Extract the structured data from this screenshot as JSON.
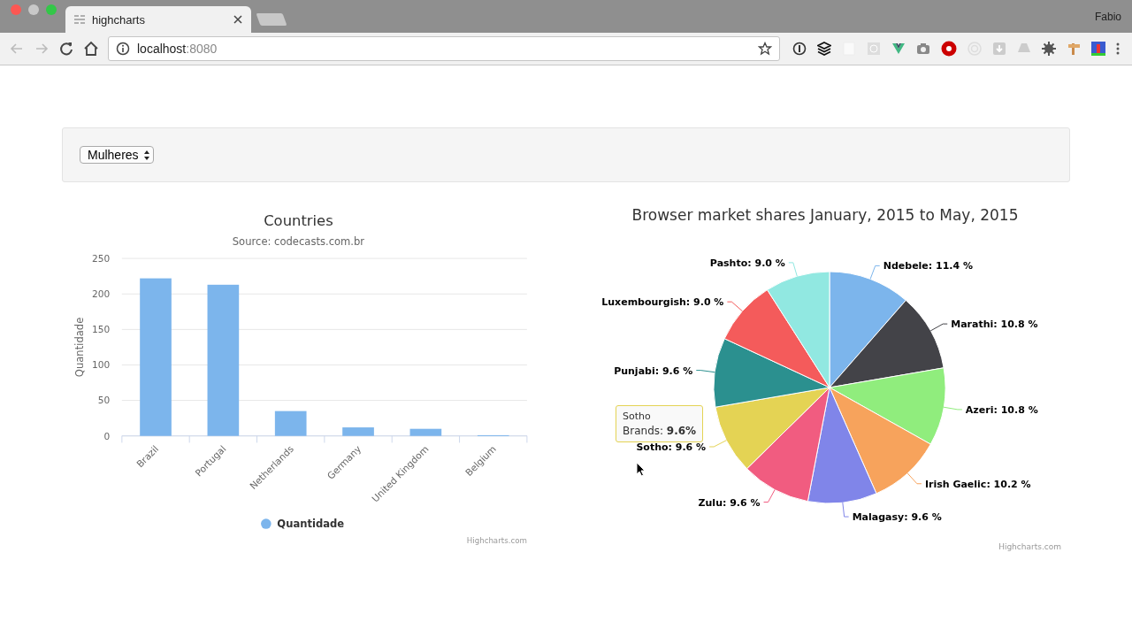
{
  "browser": {
    "tab": {
      "title": "highcharts",
      "selected": true
    },
    "address": {
      "host": "localhost",
      "port": ":8080"
    },
    "profile": "Fabio"
  },
  "filter": {
    "value": "Mulheres"
  },
  "bar_chart": {
    "subtitle": "Source: codecasts.com.br",
    "credits": "Highcharts.com",
    "chart_data": {
      "type": "bar",
      "title": "Countries",
      "ylabel": "Quantidade",
      "categories": [
        "Brazil",
        "Portugal",
        "Netherlands",
        "Germany",
        "United Kingdom",
        "Belgium"
      ],
      "series": [
        {
          "name": "Quantidade",
          "color": "#7cb5ec",
          "values": [
            222,
            213,
            35,
            12,
            10,
            1
          ]
        }
      ],
      "ylim": [
        0,
        250
      ],
      "yticks": [
        0,
        50,
        100,
        150,
        200,
        250
      ],
      "grid": true
    }
  },
  "pie_chart": {
    "credits": "Highcharts.com",
    "tooltip": {
      "title": "Sotho",
      "value": "9.6%"
    },
    "label_separator": ": ",
    "value_suffix": " %",
    "value_labels": [
      "11.4",
      "10.8",
      "10.8",
      "10.2",
      "9.6",
      "9.6",
      "9.6",
      "9.6",
      "9.0",
      "9.0"
    ],
    "chart_data": {
      "type": "pie",
      "title": "Browser market shares January, 2015 to May, 2015",
      "categories": [
        "Ndebele",
        "Marathi",
        "Azeri",
        "Irish Gaelic",
        "Malagasy",
        "Zulu",
        "Sotho",
        "Punjabi",
        "Luxembourgish",
        "Pashto"
      ],
      "series": [
        {
          "name": "Brands",
          "values": [
            11.4,
            10.8,
            10.8,
            10.2,
            9.6,
            9.6,
            9.6,
            9.6,
            9.0,
            9.0
          ]
        }
      ],
      "colors": [
        "#7cb5ec",
        "#434348",
        "#90ed7d",
        "#f7a35c",
        "#8085e9",
        "#f15c80",
        "#e4d354",
        "#2b908f",
        "#f45b5b",
        "#91e8e1"
      ]
    }
  }
}
